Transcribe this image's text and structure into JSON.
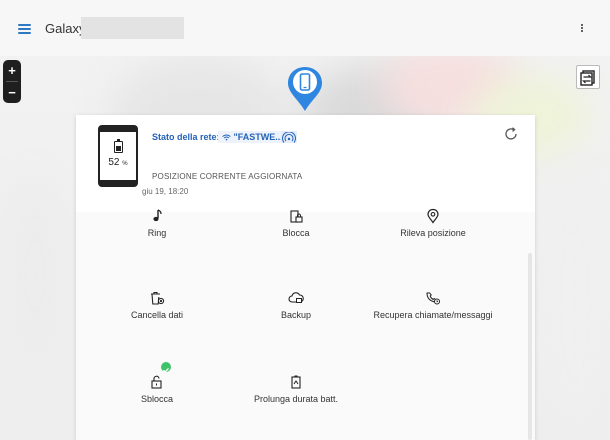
{
  "header": {
    "title": "Galaxy"
  },
  "map": {
    "zoom_in_label": "+",
    "zoom_out_label": "−"
  },
  "device": {
    "battery_value": "52",
    "battery_unit": "%"
  },
  "network": {
    "label": "Stato della rete:",
    "name": "\"FASTWE..."
  },
  "location": {
    "status": "POSIZIONE CORRENTE AGGIORNATA",
    "time": "giu 19, 18:20"
  },
  "actions": [
    {
      "label": "Ring",
      "icon": "ring-icon"
    },
    {
      "label": "Blocca",
      "icon": "lock-phone-icon"
    },
    {
      "label": "Rileva posizione",
      "icon": "location-icon"
    },
    {
      "label": "Cancella dati",
      "icon": "erase-data-icon"
    },
    {
      "label": "Backup",
      "icon": "cloud-backup-icon"
    },
    {
      "label": "Recupera chiamate/messaggi",
      "icon": "retrieve-calls-icon"
    },
    {
      "label": "Sblocca",
      "icon": "unlock-icon",
      "badge": "check"
    },
    {
      "label": "Prolunga durata batt.",
      "icon": "battery-extend-icon"
    }
  ],
  "colors": {
    "accent": "#2f78c4",
    "pin": "#2f86e0",
    "check": "#3fc36a"
  }
}
